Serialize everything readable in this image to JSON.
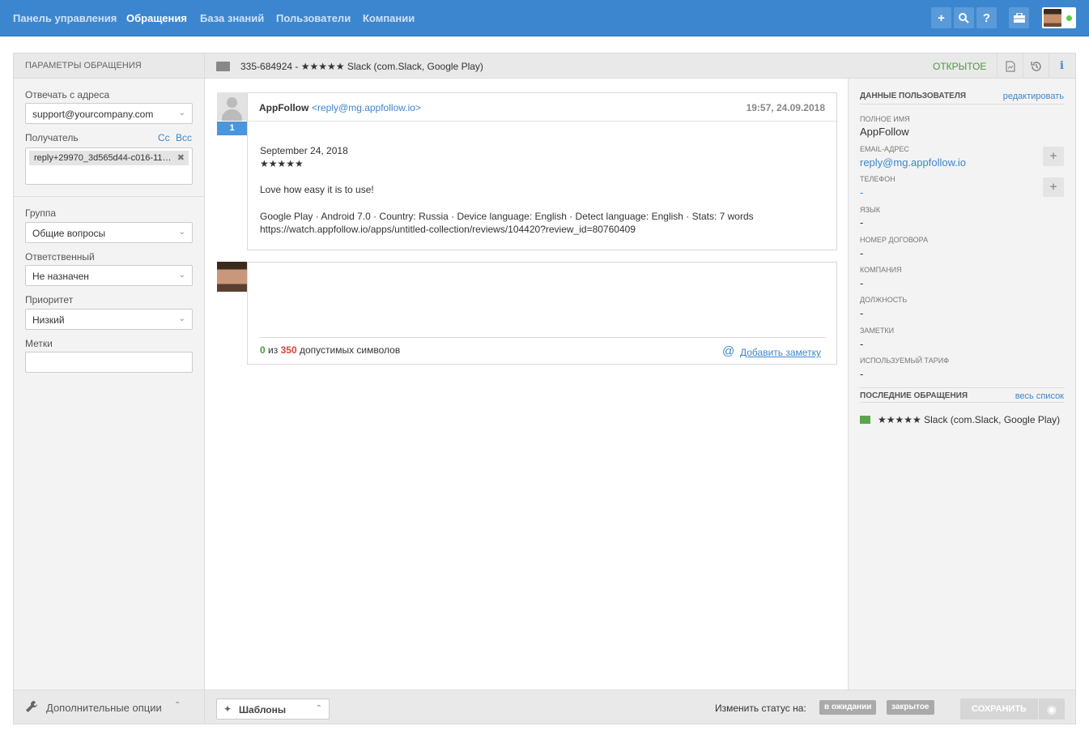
{
  "nav": {
    "items": [
      {
        "label": "Панель управления",
        "active": false
      },
      {
        "label": "Обращения",
        "active": true
      },
      {
        "label": "База знаний",
        "active": false
      },
      {
        "label": "Пользователи",
        "active": false
      },
      {
        "label": "Компании",
        "active": false
      }
    ],
    "buttons": [
      "plus-icon",
      "search-icon",
      "help-icon",
      "briefcase-icon"
    ],
    "brand_color": "#3c86cf"
  },
  "left": {
    "header": "ПАРАМЕТРЫ ОБРАЩЕНИЯ",
    "reply_from_label": "Отвечать с адреса",
    "reply_from_value": "support@yourcompany.com",
    "recipient_label": "Получатель",
    "cc_label": "Cc",
    "bcc_label": "Bcc",
    "recipient_tag": "reply+29970_3d565d44-c016-11…",
    "group_label": "Группа",
    "group_value": "Общие вопросы",
    "assignee_label": "Ответственный",
    "assignee_value": "Не назначен",
    "priority_label": "Приоритет",
    "priority_value": "Низкий",
    "tags_label": "Метки",
    "footer_label": "Дополнительные опции"
  },
  "ticket": {
    "title": "335-684924 - ★★★★★ Slack (com.Slack, Google Play)",
    "status": "ОТКРЫТОЕ",
    "status_color": "#4a9a3b"
  },
  "message": {
    "number": "1",
    "from_name": "AppFollow",
    "from_email": "<reply@mg.appfollow.io>",
    "time": "19:57, 24.09.2018",
    "lines": [
      "September 24, 2018",
      "★★★★★",
      "Love how easy it is to use!",
      "Google Play · Android 7.0 · Country: Russia · Device language: English · Detect language: English · Stats: 7 words",
      "https://watch.appfollow.io/apps/untitled-collection/reviews/104420?review_id=80760409"
    ]
  },
  "reply": {
    "count": "0",
    "of": "из",
    "max": "350",
    "suffix": "допустимых символов",
    "add_note": "Добавить заметку"
  },
  "footer": {
    "templates_label": "Шаблоны",
    "change_status_label": "Изменить статус на:",
    "status_waiting": "в ожидании",
    "status_closed": "закрытое",
    "save_label": "СОХРАНИТЬ"
  },
  "user": {
    "section_title": "ДАННЫЕ ПОЛЬЗОВАТЕЛЯ",
    "edit_link": "редактировать",
    "fields": [
      {
        "label": "ПОЛНОЕ ИМЯ",
        "value": "AppFollow"
      },
      {
        "label": "EMAIL-АДРЕС",
        "value": "reply@mg.appfollow.io"
      },
      {
        "label": "ТЕЛЕФОН",
        "value": "-"
      },
      {
        "label": "ЯЗЫК",
        "value": "-"
      },
      {
        "label": "НОМЕР ДОГОВОРА",
        "value": "-"
      },
      {
        "label": "КОМПАНИЯ",
        "value": "-"
      },
      {
        "label": "ДОЛЖНОСТЬ",
        "value": "-"
      },
      {
        "label": "ЗАМЕТКИ",
        "value": "-"
      },
      {
        "label": "ИСПОЛЬЗУЕМЫЙ ТАРИФ",
        "value": "-"
      }
    ],
    "recent_title": "ПОСЛЕДНИЕ ОБРАЩЕНИЯ",
    "recent_link": "весь список",
    "recent_item": "★★★★★ Slack (com.Slack, Google Play)"
  }
}
